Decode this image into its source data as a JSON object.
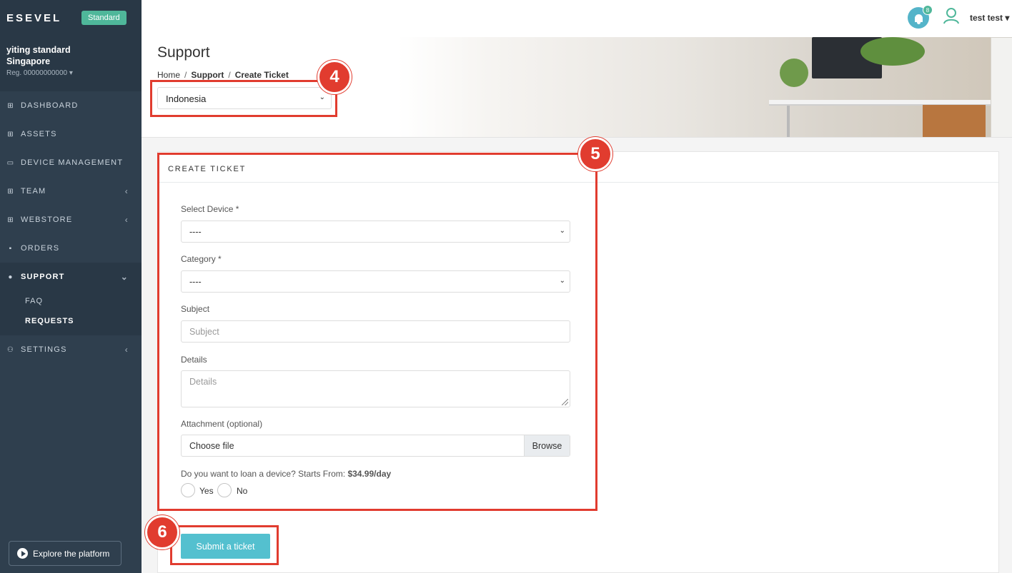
{
  "sidebar": {
    "brand": "ESEVEL",
    "plan_badge": "Standard",
    "org_name_line1": "yiting standard",
    "org_name_line2": "Singapore",
    "org_reg": "Reg. 00000000000",
    "items": [
      {
        "label": "DASHBOARD",
        "icon": "grid-icon"
      },
      {
        "label": "ASSETS",
        "icon": "grid-icon"
      },
      {
        "label": "DEVICE MANAGEMENT",
        "icon": "laptop-icon"
      },
      {
        "label": "TEAM",
        "icon": "grid-icon"
      },
      {
        "label": "WEBSTORE",
        "icon": "grid-icon"
      },
      {
        "label": "ORDERS",
        "icon": "document-icon"
      },
      {
        "label": "SUPPORT",
        "icon": "info-icon"
      },
      {
        "label": "SETTINGS",
        "icon": "users-icon"
      }
    ],
    "support_sub": [
      "FAQ",
      "REQUESTS"
    ],
    "explore_label": "Explore the platform"
  },
  "topbar": {
    "notification_count": "8",
    "user_name": "test test"
  },
  "header": {
    "title": "Support",
    "breadcrumb": [
      "Home",
      "Support",
      "Create Ticket"
    ],
    "country_value": "Indonesia"
  },
  "form": {
    "card_title": "CREATE TICKET",
    "device_label": "Select Device *",
    "device_value": "----",
    "category_label": "Category *",
    "category_value": "----",
    "subject_label": "Subject",
    "subject_placeholder": "Subject",
    "details_label": "Details",
    "details_placeholder": "Details",
    "attachment_label": "Attachment (optional)",
    "attachment_value": "Choose file",
    "browse_label": "Browse",
    "loan_question": "Do you want to loan a device? Starts From: ",
    "loan_price": "$34.99/day",
    "loan_yes": "Yes",
    "loan_no": "No",
    "submit_label": "Submit a ticket"
  },
  "annotations": [
    "4",
    "5",
    "6"
  ],
  "colors": {
    "sidebar_bg": "#2f3f4e",
    "accent": "#54c0cf",
    "badge_green": "#4fb79a",
    "annotation_red": "#e13c2f"
  }
}
